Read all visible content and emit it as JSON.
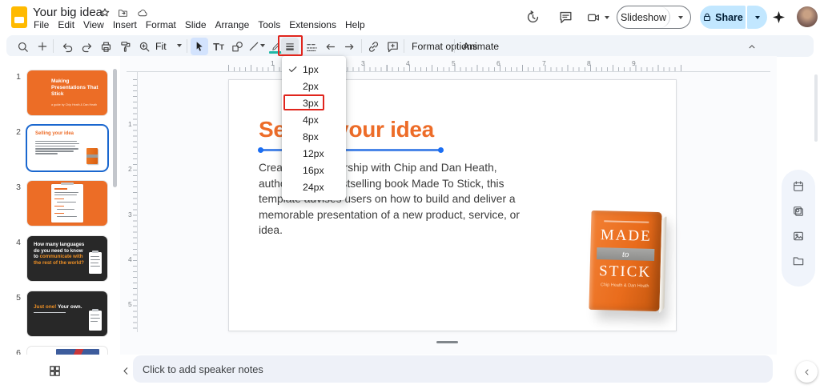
{
  "app": {
    "title": "Your big idea"
  },
  "header": {
    "menus": [
      "File",
      "Edit",
      "View",
      "Insert",
      "Format",
      "Slide",
      "Arrange",
      "Tools",
      "Extensions",
      "Help"
    ],
    "slideshow_label": "Slideshow",
    "share_label": "Share"
  },
  "toolbar": {
    "fit_label": "Fit",
    "format_options_label": "Format options",
    "animate_label": "Animate"
  },
  "line_weight_menu": {
    "items": [
      "1px",
      "2px",
      "3px",
      "4px",
      "8px",
      "12px",
      "16px",
      "24px"
    ],
    "checked_item": "1px",
    "annotated_item": "3px"
  },
  "filmstrip": {
    "numbers": [
      "1",
      "2",
      "3",
      "4",
      "5",
      "6"
    ],
    "slide1": {
      "title": "Making Presentations That Stick",
      "subtitle": "a guide by Chip Heath & Dan Heath"
    },
    "slide2": {
      "title": "Selling your idea"
    },
    "slide4": {
      "line_white": "How many languages do you need to know to ",
      "line_orange": "communicate with the rest of the world?"
    },
    "slide5": {
      "accent": "Just one!",
      "rest": " Your own."
    }
  },
  "rulers": {
    "horizontal": [
      "1",
      "2",
      "3",
      "4",
      "5",
      "6",
      "7",
      "8",
      "9"
    ],
    "vertical": [
      "1",
      "2",
      "3",
      "4",
      "5"
    ]
  },
  "slide": {
    "title": "Selling your idea",
    "body": "Created in partnership with Chip and Dan Heath, authors of the bestselling book Made To Stick, this template advises users on how to build and deliver a memorable presentation of a new product, service, or idea.",
    "book": {
      "word1": "MADE",
      "word2": "to",
      "word3": "STICK",
      "authors": "Chip Heath & Dan Heath"
    }
  },
  "notes": {
    "placeholder": "Click to add speaker notes"
  },
  "colors": {
    "accent_orange": "#ed6c28",
    "selection_blue": "#1a73e8",
    "annotation_red": "#e0251d",
    "share_bg": "#c2e7ff",
    "toolbar_bg": "#f0f4f9",
    "dark_slide": "#282828"
  }
}
